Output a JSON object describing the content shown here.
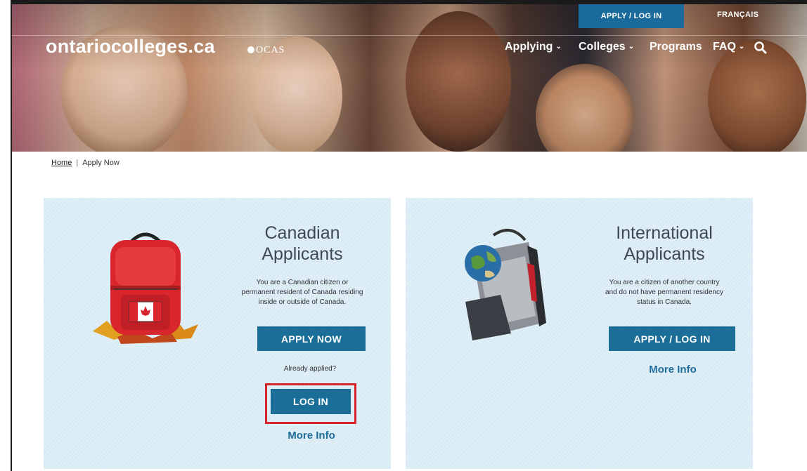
{
  "header": {
    "apply_login": "APPLY / LOG IN",
    "language": "FRANÇAIS",
    "logo": "ontariocolleges.ca",
    "logo_partner": "OCAS",
    "nav": [
      {
        "label": "Applying"
      },
      {
        "label": "Colleges"
      },
      {
        "label": "Programs"
      },
      {
        "label": "FAQ"
      }
    ]
  },
  "breadcrumb": {
    "home": "Home",
    "separator": "|",
    "current": "Apply Now"
  },
  "cards": {
    "canadian": {
      "title_line1": "Canadian",
      "title_line2": "Applicants",
      "desc_line1": "You are a Canadian citizen or",
      "desc_line2": "permanent resident of Canada residing",
      "desc_line3": "inside or outside of Canada.",
      "apply_button": "APPLY NOW",
      "already_applied": "Already applied?",
      "login_button": "LOG IN",
      "more_info": "More Info"
    },
    "international": {
      "title_line1": "International",
      "title_line2": "Applicants",
      "desc_line1": "You are a citizen of another country",
      "desc_line2": "and do not have permanent residency",
      "desc_line3": "status in Canada.",
      "apply_button": "APPLY / LOG IN",
      "more_info": "More Info"
    }
  },
  "colors": {
    "button_blue": "#1b6e98",
    "top_button_blue": "#1b6a9c",
    "card_bg": "#d9ebf5",
    "highlight_red": "#d8232a",
    "link_blue": "#1f6d9b"
  },
  "icons": [
    "chevron-down-icon",
    "search-icon",
    "red-backpack-icon",
    "gray-backpack-icon",
    "maple-leaf-icon"
  ]
}
